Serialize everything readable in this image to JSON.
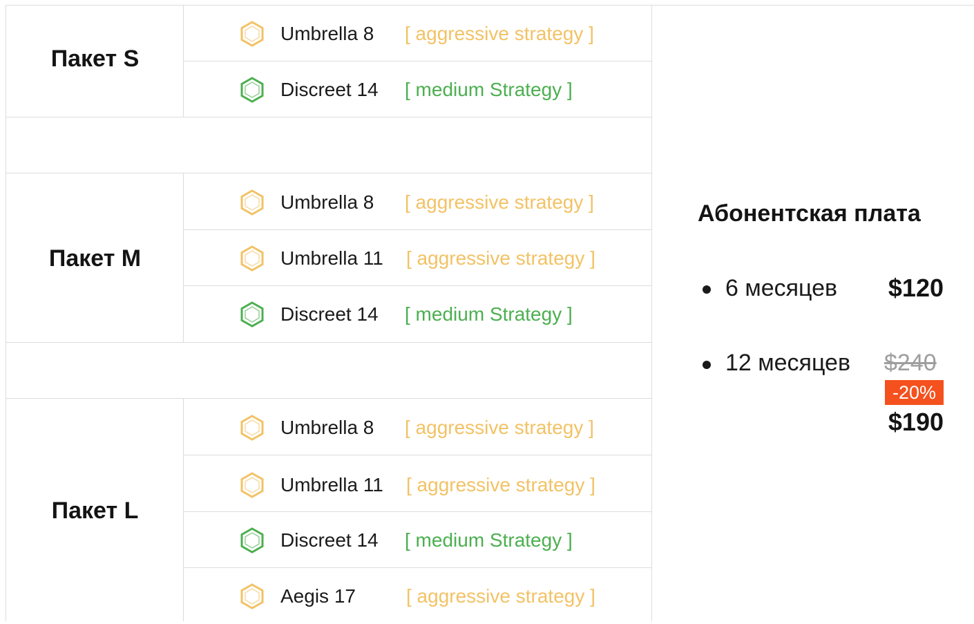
{
  "packages": [
    {
      "name": "Пакет S",
      "rows": [
        {
          "product": "Umbrella 8",
          "strategy": "[ aggressive strategy ]",
          "kind": "aggressive"
        },
        {
          "product": "Discreet 14",
          "strategy": "[ medium Strategy ]",
          "kind": "medium"
        }
      ]
    },
    {
      "name": "Пакет M",
      "rows": [
        {
          "product": "Umbrella 8",
          "strategy": "[ aggressive strategy ]",
          "kind": "aggressive"
        },
        {
          "product": "Umbrella 11",
          "strategy": "[ aggressive strategy ]",
          "kind": "aggressive"
        },
        {
          "product": "Discreet 14",
          "strategy": "[ medium Strategy ]",
          "kind": "medium"
        }
      ]
    },
    {
      "name": "Пакет L",
      "rows": [
        {
          "product": "Umbrella 8",
          "strategy": "[ aggressive strategy ]",
          "kind": "aggressive"
        },
        {
          "product": "Umbrella 11",
          "strategy": "[ aggressive strategy ]",
          "kind": "aggressive"
        },
        {
          "product": "Discreet 14",
          "strategy": "[ medium Strategy ]",
          "kind": "medium"
        },
        {
          "product": "Aegis 17",
          "strategy": "[ aggressive strategy ]",
          "kind": "aggressive"
        }
      ]
    }
  ],
  "subscription": {
    "title": "Абонентская плата",
    "plans": [
      {
        "period": "6 месяцев",
        "price": "$120"
      },
      {
        "period": "12 месяцев",
        "old_price": "$240",
        "discount": "-20%",
        "price": "$190"
      }
    ]
  },
  "icons": {
    "aggressive": "hexagon-orange-icon",
    "medium": "hexagon-green-icon"
  },
  "colors": {
    "aggressive": "#f2c265",
    "medium": "#4caf50",
    "discount_badge": "#f4511e",
    "old_price": "#9e9e9e",
    "grid_line": "#dcdcdc"
  }
}
